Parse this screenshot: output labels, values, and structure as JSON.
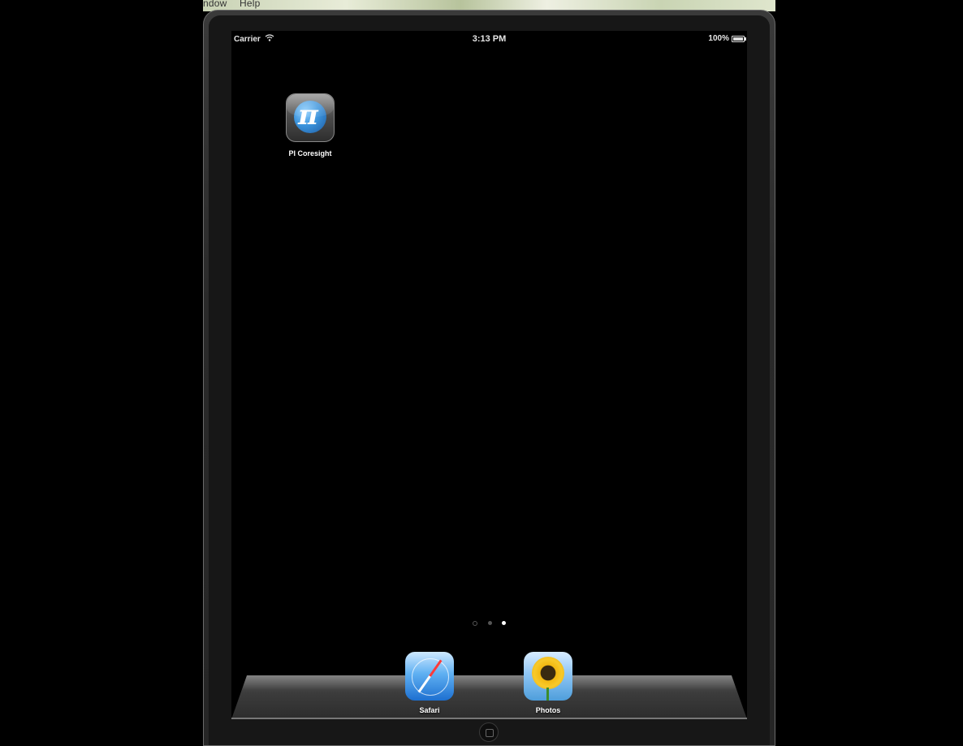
{
  "host_menu": {
    "items": [
      "ndow",
      "Help"
    ]
  },
  "status_bar": {
    "carrier": "Carrier",
    "time": "3:13 PM",
    "battery": "100%"
  },
  "home_screen": {
    "apps": [
      {
        "label": "PI Coresight",
        "icon": "pi-coresight-icon"
      }
    ],
    "page_dots": {
      "count": 2,
      "active_index": 1,
      "has_search": true
    }
  },
  "dock": {
    "apps": [
      {
        "label": "Safari",
        "icon": "safari-compass-icon"
      },
      {
        "label": "Photos",
        "icon": "sunflower-icon"
      }
    ]
  }
}
